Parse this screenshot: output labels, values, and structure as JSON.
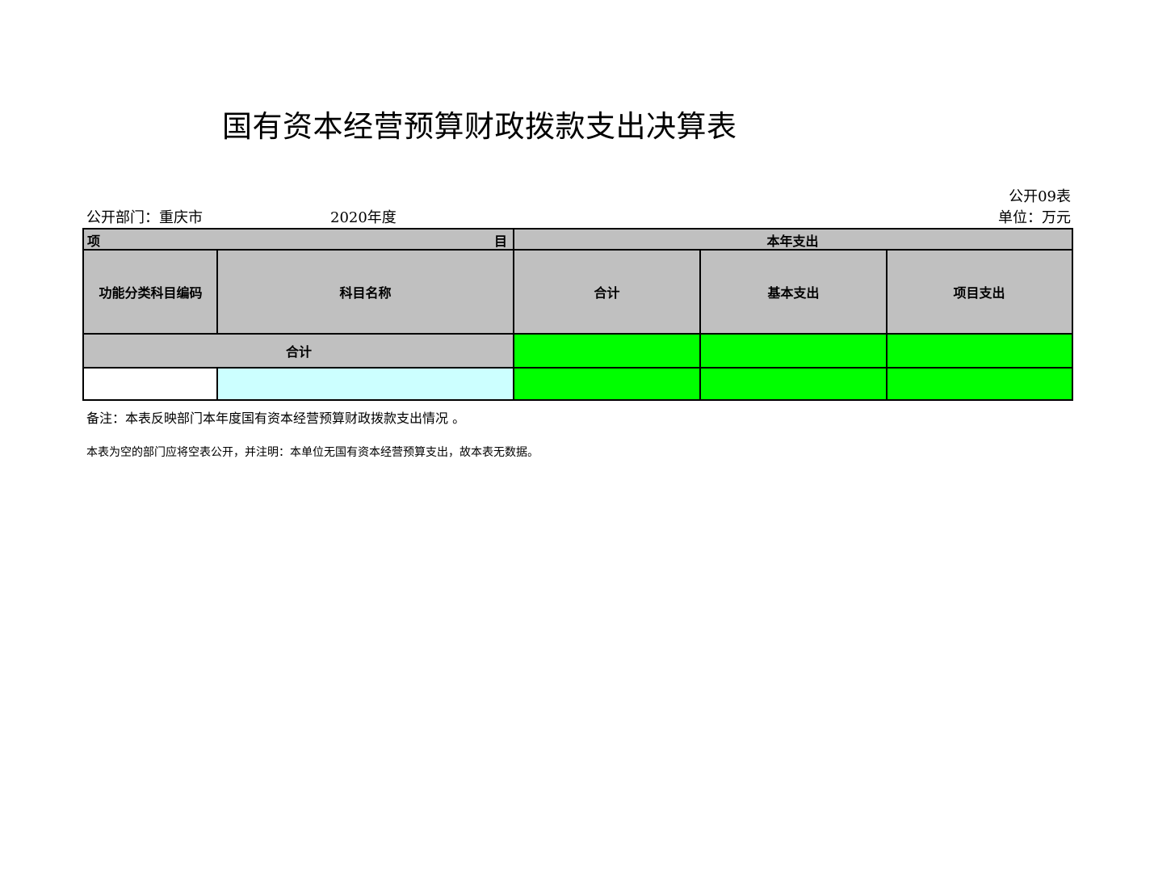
{
  "title": "国有资本经营预算财政拨款支出决算表",
  "meta": {
    "dept": "公开部门：重庆市",
    "year": "2020年度",
    "table_code": "公开09表",
    "unit": "单位：万元"
  },
  "table": {
    "header_item_left": "项",
    "header_item_right": "目",
    "header_current_year": "本年支出",
    "col_code": "功能分类科目编码",
    "col_name": "科目名称",
    "col_total": "合计",
    "col_basic": "基本支出",
    "col_project": "项目支出",
    "row_total_label": "合计",
    "row_total_values": [
      "",
      "",
      ""
    ],
    "data_row": {
      "code": "",
      "name": "",
      "values": [
        "",
        "",
        ""
      ]
    }
  },
  "notes": {
    "note1": "备注：本表反映部门本年度国有资本经营预算财政拨款支出情况 。",
    "note2": "本表为空的部门应将空表公开，并注明：本单位无国有资本经营预算支出，故本表无数据。"
  },
  "colors": {
    "header_fill": "#c0c0c0",
    "value_fill": "#00ff00",
    "name_fill": "#ccffff"
  }
}
